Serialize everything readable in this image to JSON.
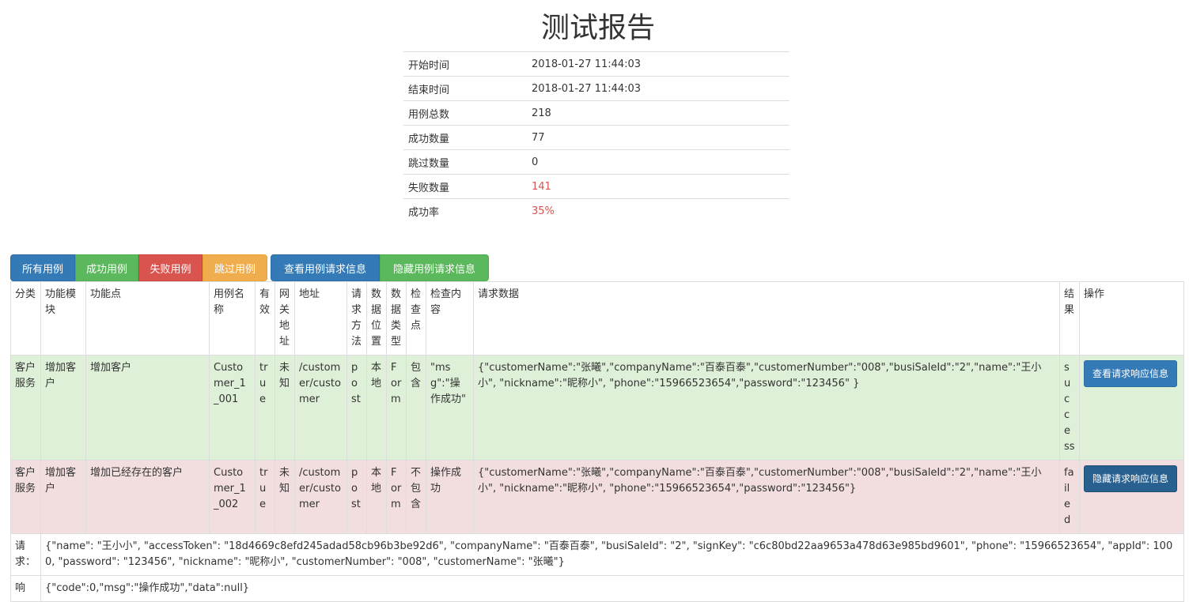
{
  "title": "测试报告",
  "summary": [
    {
      "label": "开始时间",
      "value": "2018-01-27 11:44:03"
    },
    {
      "label": "结束时间",
      "value": "2018-01-27 11:44:03"
    },
    {
      "label": "用例总数",
      "value": "218"
    },
    {
      "label": "成功数量",
      "value": "77"
    },
    {
      "label": "跳过数量",
      "value": "0"
    },
    {
      "label": "失败数量",
      "value": "141"
    },
    {
      "label": "成功率",
      "value": "35%"
    }
  ],
  "colors": {
    "danger_text": "#d9534f",
    "pass_row": "#dff0d8",
    "fail_row": "#f2dede",
    "primary": "#337ab7"
  },
  "toolbar": {
    "all": "所有用例",
    "passed": "成功用例",
    "failed": "失败用例",
    "skipped": "跳过用例",
    "show_requests": "查看用例请求信息",
    "hide_requests": "隐藏用例请求信息"
  },
  "headers": [
    "分类",
    "功能模块",
    "功能点",
    "用例名称",
    "有效",
    "网关地址",
    "地址",
    "请求方法",
    "数据位置",
    "数据类型",
    "检查点",
    "检查内容",
    "请求数据",
    "结果",
    "操作"
  ],
  "rows": [
    {
      "category": "客户服务",
      "module": "增加客户",
      "point": "增加客户",
      "name": "Customer_1_001",
      "valid": "true",
      "gateway": "未知",
      "url": "/customer/customer",
      "method": "post",
      "data_location": "本地",
      "data_type": "Form",
      "check_point": "包含",
      "check_content": "\"msg\":\"操作成功\"",
      "request_data": "{\"customerName\":\"张曦\",\"companyName\":\"百泰百泰\",\"customerNumber\":\"008\",\"busiSaleId\":\"2\",\"name\":\"王小小\", \"nickname\":\"昵称小\", \"phone\":\"15966523654\",\"password\":\"123456\" }",
      "result": "success",
      "action": "查看请求响应信息"
    },
    {
      "category": "客户服务",
      "module": "增加客户",
      "point": "增加已经存在的客户",
      "name": "Customer_1_002",
      "valid": "true",
      "gateway": "未知",
      "url": "/customer/customer",
      "method": "post",
      "data_location": "本地",
      "data_type": "Form",
      "check_point": "不包含",
      "check_content": "操作成功",
      "request_data": "{\"customerName\":\"张曦\",\"companyName\":\"百泰百泰\",\"customerNumber\":\"008\",\"busiSaleId\":\"2\",\"name\":\"王小小\", \"nickname\":\"昵称小\", \"phone\":\"15966523654\",\"password\":\"123456\"}",
      "result": "failed",
      "action": "隐藏请求响应信息"
    }
  ],
  "detail": {
    "request_label": "请求：",
    "request_value": "{\"name\": \"王小小\", \"accessToken\": \"18d4669c8efd245adad58cb96b3be92d6\", \"companyName\": \"百泰百泰\", \"busiSaleId\": \"2\", \"signKey\": \"c6c80bd22aa9653a478d63e985bd9601\", \"phone\": \"15966523654\", \"appId\": 1000, \"password\": \"123456\", \"nickname\": \"昵称小\", \"customerNumber\": \"008\", \"customerName\": \"张曦\"}",
    "response_label": "响",
    "response_value": "{\"code\":0,\"msg\":\"操作成功\",\"data\":null}"
  }
}
